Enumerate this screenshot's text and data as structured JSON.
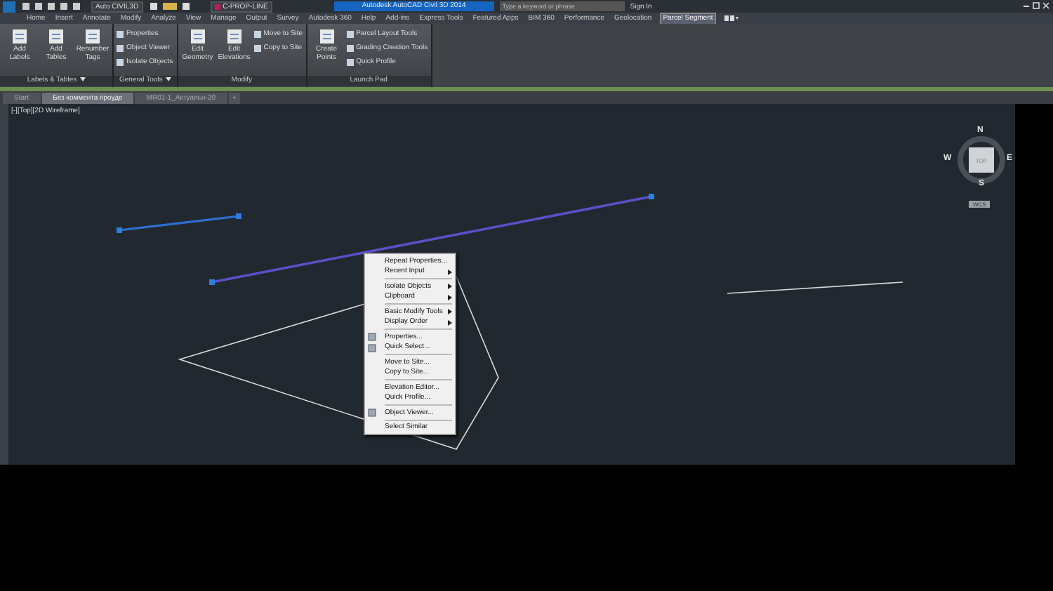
{
  "title_bar": {
    "workspace": "Auto CIVIL3D",
    "layer": "C-PROP-LINE",
    "title": "Autodesk AutoCAD Civil 3D 2014",
    "search": {
      "placeholder": "Type a keyword or phrase"
    },
    "sign_in": "Sign In"
  },
  "ribbon_tabs": [
    {
      "label": "Home",
      "selected": false
    },
    {
      "label": "Insert",
      "selected": false
    },
    {
      "label": "Annotate",
      "selected": false
    },
    {
      "label": "Modify",
      "selected": false
    },
    {
      "label": "Analyze",
      "selected": false
    },
    {
      "label": "View",
      "selected": false
    },
    {
      "label": "Manage",
      "selected": false
    },
    {
      "label": "Output",
      "selected": false
    },
    {
      "label": "Survey",
      "selected": false
    },
    {
      "label": "Autodesk 360",
      "selected": false
    },
    {
      "label": "Help",
      "selected": false
    },
    {
      "label": "Add-ins",
      "selected": false
    },
    {
      "label": "Express Tools",
      "selected": false
    },
    {
      "label": "Featured Apps",
      "selected": false
    },
    {
      "label": "BIM 360",
      "selected": false
    },
    {
      "label": "Performance",
      "selected": false
    },
    {
      "label": "Geolocation",
      "selected": false
    },
    {
      "label": "Parcel Segment",
      "selected": true
    }
  ],
  "ribbon_panels": [
    {
      "title": "Labels & Tables",
      "menu": true,
      "tools": [
        {
          "label": "Add Labels",
          "kind": "large"
        },
        {
          "label": "Add Tables",
          "kind": "large"
        },
        {
          "label": "Renumber Tags",
          "kind": "large"
        }
      ]
    },
    {
      "title": "General Tools",
      "menu": true,
      "tools": [
        {
          "label": "Properties",
          "kind": "small"
        },
        {
          "label": "Object Viewer",
          "kind": "small"
        },
        {
          "label": "Isolate Objects",
          "kind": "small"
        }
      ]
    },
    {
      "title": "Modify",
      "menu": false,
      "tools": [
        {
          "label": "Edit Geometry",
          "kind": "large"
        },
        {
          "label": "Edit Elevations",
          "kind": "large"
        },
        {
          "label": "Move to Site",
          "kind": "small"
        },
        {
          "label": "Copy to Site",
          "kind": "small"
        }
      ]
    },
    {
      "title": "Launch Pad",
      "menu": false,
      "tools": [
        {
          "label": "Create Points",
          "kind": "large"
        },
        {
          "label": "Parcel Layout Tools",
          "kind": "small"
        },
        {
          "label": "Grading Creation Tools",
          "kind": "small"
        },
        {
          "label": "Quick Profile",
          "kind": "small"
        }
      ]
    }
  ],
  "document_tabs": [
    {
      "label": "Start",
      "selected": false
    },
    {
      "label": "Без коммента проуде",
      "selected": true
    },
    {
      "label": "MR01-1_Актуальн-20",
      "selected": false
    }
  ],
  "new_tab": "+",
  "viewport": {
    "label": "[-][Top][2D Wireframe]",
    "viewcube": {
      "north": "N",
      "south": "S",
      "west": "W",
      "east": "E",
      "face": "TOP",
      "ucs": "WCS"
    }
  },
  "context_menu": [
    {
      "kind": "item",
      "label": "Repeat Properties...",
      "submenu": false,
      "icon": false
    },
    {
      "kind": "item",
      "label": "Recent Input",
      "submenu": true,
      "icon": false
    },
    {
      "kind": "separator"
    },
    {
      "kind": "item",
      "label": "Isolate Objects",
      "submenu": true,
      "icon": false
    },
    {
      "kind": "item",
      "label": "Clipboard",
      "submenu": true,
      "icon": false
    },
    {
      "kind": "separator"
    },
    {
      "kind": "item",
      "label": "Basic Modify Tools",
      "submenu": true,
      "icon": false
    },
    {
      "kind": "item",
      "label": "Display Order",
      "submenu": true,
      "icon": false
    },
    {
      "kind": "separator"
    },
    {
      "kind": "item",
      "label": "Properties...",
      "submenu": false,
      "icon": true
    },
    {
      "kind": "item",
      "label": "Quick Select...",
      "submenu": false,
      "icon": true
    },
    {
      "kind": "separator"
    },
    {
      "kind": "item",
      "label": "Move to Site...",
      "submenu": false,
      "icon": false
    },
    {
      "kind": "item",
      "label": "Copy to Site...",
      "submenu": false,
      "icon": false
    },
    {
      "kind": "separator"
    },
    {
      "kind": "item",
      "label": "Elevation Editor...",
      "submenu": false,
      "icon": false
    },
    {
      "kind": "item",
      "label": "Quick Profile...",
      "submenu": false,
      "icon": false
    },
    {
      "kind": "separator"
    },
    {
      "kind": "item",
      "label": "Object Viewer...",
      "submenu": false,
      "icon": true
    },
    {
      "kind": "separator"
    },
    {
      "kind": "item",
      "label": "Select Similar",
      "submenu": false,
      "icon": false
    }
  ]
}
